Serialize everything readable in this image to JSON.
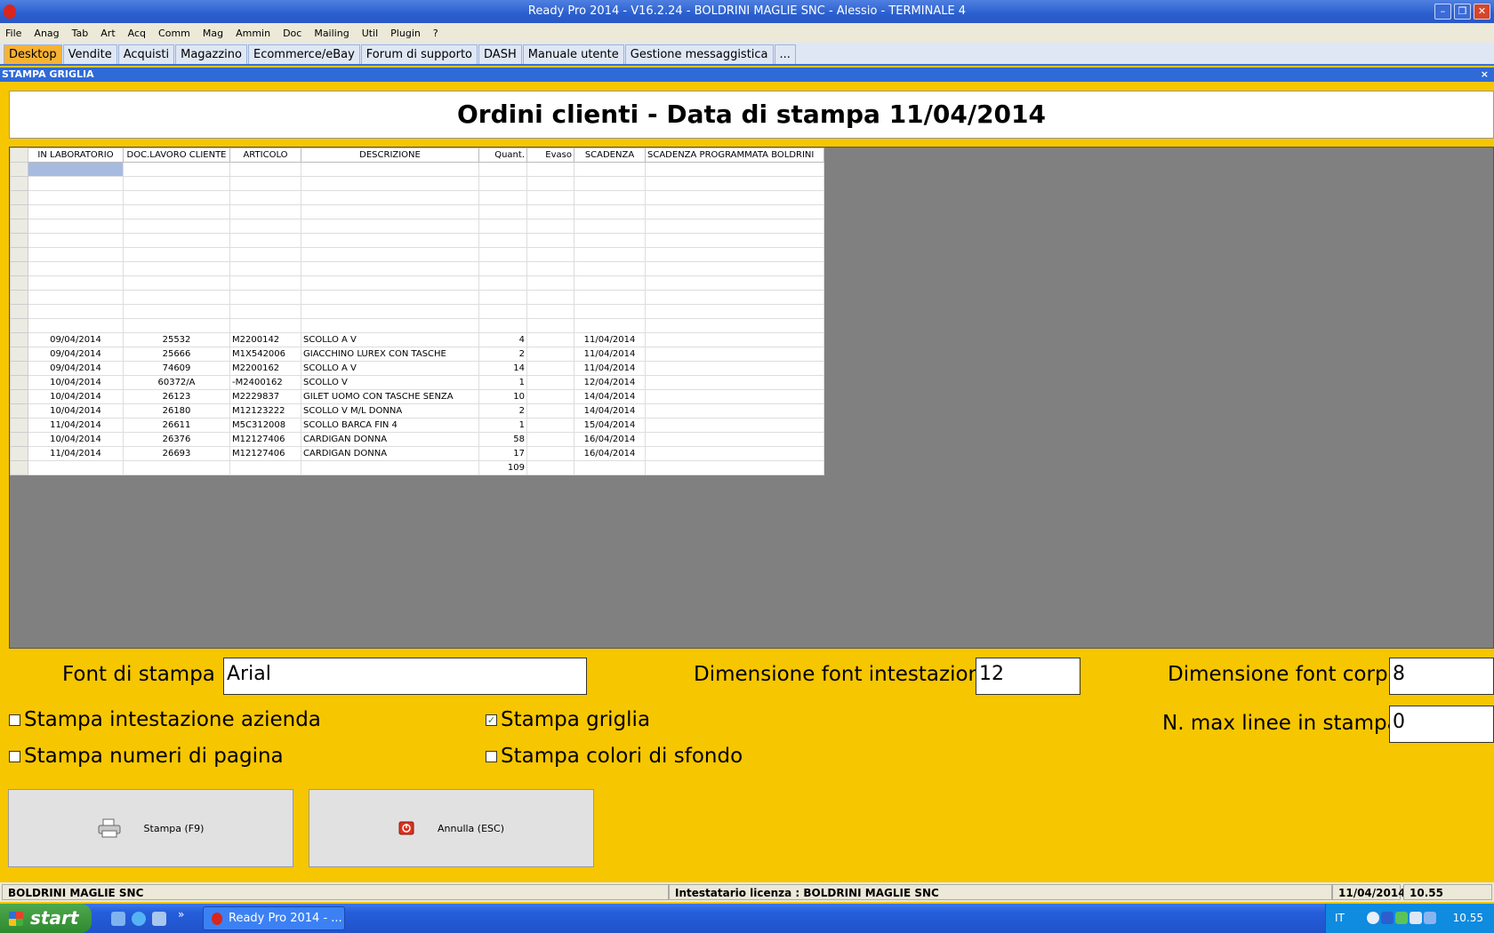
{
  "window": {
    "title": "Ready Pro 2014 - V16.2.24 - BOLDRINI MAGLIE SNC - Alessio - TERMINALE 4",
    "min_label": "–",
    "max_label": "❐",
    "close_label": "✕"
  },
  "menu": [
    "File",
    "Anag",
    "Tab",
    "Art",
    "Acq",
    "Comm",
    "Mag",
    "Ammin",
    "Doc",
    "Mailing",
    "Util",
    "Plugin",
    "?"
  ],
  "tabs": [
    "Desktop",
    "Vendite",
    "Acquisti",
    "Magazzino",
    "Ecommerce/eBay",
    "Forum di supporto",
    "DASH",
    "Manuale utente",
    "Gestione messaggistica",
    "..."
  ],
  "panel": {
    "title": "STAMPA GRIGLIA",
    "close_label": "×"
  },
  "report_title": "Ordini clienti - Data di stampa 11/04/2014",
  "grid": {
    "columns": [
      "IN LABORATORIO",
      "DOC.LAVORO  CLIENTE",
      "ARTICOLO",
      "DESCRIZIONE",
      "Quant.",
      "Evaso",
      "SCADENZA",
      "SCADENZA PROGRAMMATA BOLDRINI"
    ],
    "rows": [
      [
        "09/04/2014",
        "25532",
        "M2200142",
        "SCOLLO A V",
        "4",
        "",
        "11/04/2014",
        ""
      ],
      [
        "09/04/2014",
        "25666",
        "M1X542006",
        "GIACCHINO LUREX CON TASCHE",
        "2",
        "",
        "11/04/2014",
        ""
      ],
      [
        "09/04/2014",
        "74609",
        "M2200162",
        "SCOLLO A V",
        "14",
        "",
        "11/04/2014",
        ""
      ],
      [
        "10/04/2014",
        "60372/A",
        "-M2400162",
        "SCOLLO V",
        "1",
        "",
        "12/04/2014",
        ""
      ],
      [
        "10/04/2014",
        "26123",
        "M2229837",
        "GILET UOMO CON TASCHE SENZA",
        "10",
        "",
        "14/04/2014",
        ""
      ],
      [
        "10/04/2014",
        "26180",
        "M12123222",
        "SCOLLO V M/L DONNA",
        "2",
        "",
        "14/04/2014",
        ""
      ],
      [
        "11/04/2014",
        "26611",
        "M5C312008",
        "SCOLLO BARCA FIN 4",
        "1",
        "",
        "15/04/2014",
        ""
      ],
      [
        "10/04/2014",
        "26376",
        "M12127406",
        "CARDIGAN DONNA",
        "58",
        "",
        "16/04/2014",
        ""
      ],
      [
        "11/04/2014",
        "26693",
        "M12127406",
        "CARDIGAN DONNA",
        "17",
        "",
        "16/04/2014",
        ""
      ]
    ],
    "total": "109"
  },
  "form": {
    "font_label": "Font di stampa :",
    "font_value": "Arial",
    "header_size_label": "Dimensione font intestazione",
    "header_size_value": "12",
    "body_size_label": "Dimensione font corpo",
    "body_size_value": "8",
    "max_lines_label": "N. max linee in stampa",
    "max_lines_value": "0",
    "checkboxes": [
      {
        "label": "Stampa intestazione azienda",
        "checked": false
      },
      {
        "label": "Stampa numeri di pagina",
        "checked": false
      },
      {
        "label": "Stampa griglia",
        "checked": true
      },
      {
        "label": "Stampa colori di sfondo",
        "checked": false
      }
    ]
  },
  "buttons": {
    "print": "Stampa (F9)",
    "cancel": "Annulla (ESC)"
  },
  "statusbar": {
    "company": "BOLDRINI MAGLIE SNC",
    "license": "Intestatario licenza : BOLDRINI MAGLIE SNC",
    "date": "11/04/2014",
    "time": "10.55"
  },
  "taskbar": {
    "start": "start",
    "task_item": "Ready Pro 2014 - ...",
    "lang": "IT",
    "clock": "10.55",
    "chevron": "»"
  },
  "colors": {
    "background": "#f6c600",
    "active_tab": "#f7b233",
    "grid_area": "#808080",
    "titlebar": "#2a5fcf"
  }
}
